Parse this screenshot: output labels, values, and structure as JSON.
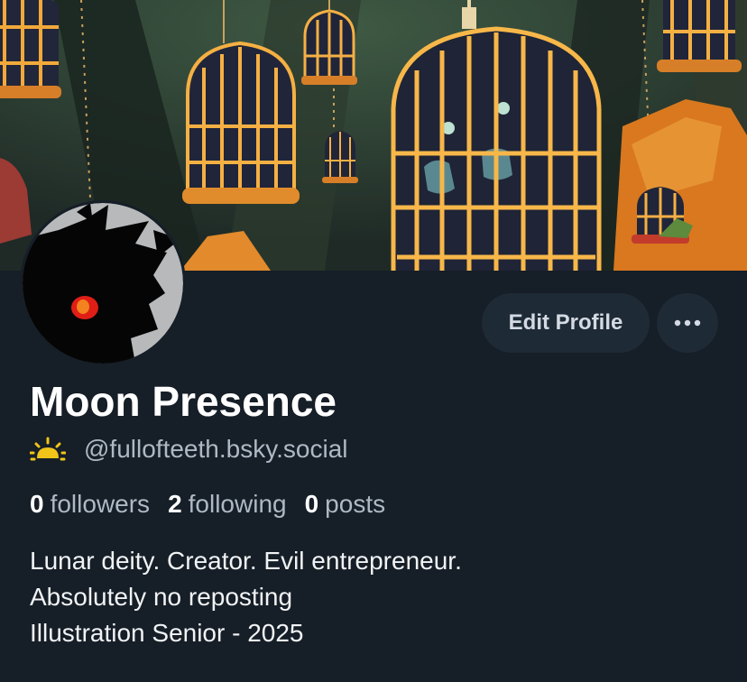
{
  "profile": {
    "display_name": "Moon Presence",
    "handle": "@fullofteeth.bsky.social",
    "handle_icon": "sunrise-icon",
    "bio_lines": [
      "Lunar deity. Creator. Evil entrepreneur.",
      "Absolutely no reposting",
      "Illustration Senior - 2025"
    ]
  },
  "stats": {
    "followers": {
      "count": "0",
      "label": "followers"
    },
    "following": {
      "count": "2",
      "label": "following"
    },
    "posts": {
      "count": "0",
      "label": "posts"
    }
  },
  "actions": {
    "edit_label": "Edit Profile",
    "more_icon": "ellipsis-icon"
  },
  "colors": {
    "background": "#161e27",
    "button_bg": "#1e2a36",
    "muted_text": "#aeb9c5",
    "sun_icon": "#f0c419"
  }
}
